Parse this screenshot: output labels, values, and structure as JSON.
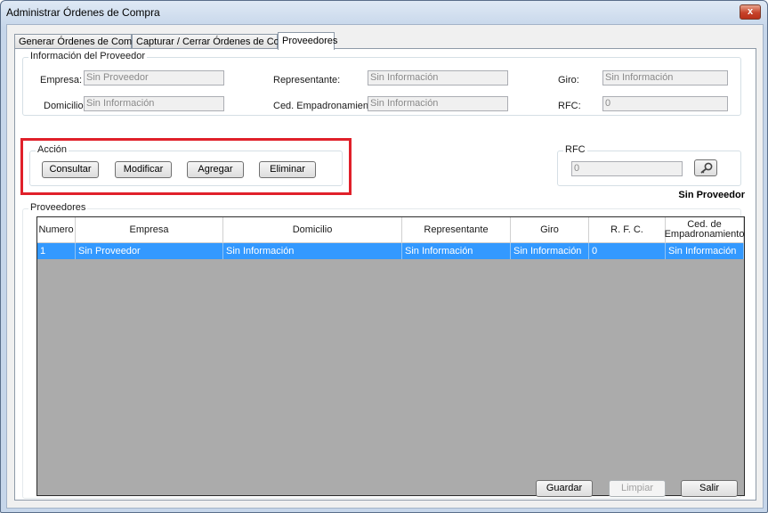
{
  "window": {
    "title": "Administrar Órdenes de Compra",
    "close_label": "x"
  },
  "tabs": [
    {
      "label": "Generar Órdenes de Compra."
    },
    {
      "label": "Capturar / Cerrar Órdenes de Compra"
    },
    {
      "label": "Proveedores"
    }
  ],
  "info": {
    "legend": "Información del Proveedor",
    "empresa_label": "Empresa:",
    "empresa_value": "Sin Proveedor",
    "representante_label": "Representante:",
    "representante_value": "Sin Información",
    "giro_label": "Giro:",
    "giro_value": "Sin Información",
    "domicilio_label": "Domicilio",
    "domicilio_value": "Sin Información",
    "ced_label": "Ced. Empadronamiento:",
    "ced_value": "Sin Información",
    "rfc_label": "RFC:",
    "rfc_value": "0"
  },
  "accion": {
    "legend": "Acción",
    "consultar": "Consultar",
    "modificar": "Modificar",
    "agregar": "Agregar",
    "eliminar": "Eliminar"
  },
  "rfc_search": {
    "legend": "RFC",
    "value": "0",
    "icon": "key-search-icon"
  },
  "status": {
    "proveedor": "Sin Proveedor"
  },
  "proveedores": {
    "legend": "Proveedores",
    "columns": [
      "Numero",
      "Empresa",
      "Domicilio",
      "Representante",
      "Giro",
      "R. F. C.",
      "Ced. de Empadronamiento"
    ],
    "rows": [
      [
        "1",
        "Sin Proveedor",
        "Sin Información",
        "Sin Información",
        "Sin Información",
        "0",
        "Sin Información"
      ]
    ]
  },
  "footer": {
    "guardar": "Guardar",
    "limpiar": "Limpiar",
    "salir": "Salir"
  }
}
